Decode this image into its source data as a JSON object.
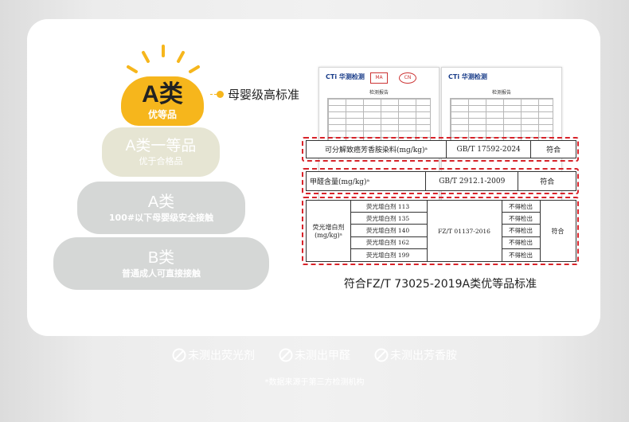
{
  "pyramid": {
    "tier_a": {
      "grade": "A类",
      "name": "优等品"
    },
    "tier_b": {
      "grade": "A类一等品",
      "name": "优于合格品"
    },
    "tier_c": {
      "grade": "A类",
      "name": "100#以下母婴级安全接触"
    },
    "tier_d": {
      "grade": "B类",
      "name": "普通成人可直接接触"
    },
    "standard_label": "母婴级高标准"
  },
  "reports": [
    {
      "logo": "CTi 华测检测",
      "title": "检测报告"
    },
    {
      "logo": "CTi 华测检测",
      "title": "检测报告"
    }
  ],
  "table": {
    "row1": {
      "item": "可分解致癌芳香胺染料(mg/kg)ᵃ",
      "standard": "GB/T 17592-2024",
      "result": "符合"
    },
    "row2": {
      "item": "甲醛含量(mg/kg)ᵃ",
      "standard": "GB/T 2912.1-2009",
      "result": "符合"
    },
    "row3": {
      "name": "荧光增白剂",
      "unit": "(mg/kg)ᵃ",
      "items": [
        "荧光增白剂 113",
        "荧光增白剂 135",
        "荧光增白剂 140",
        "荧光增白剂 162",
        "荧光增白剂 199"
      ],
      "standard": "FZ/T 01137-2016",
      "results": [
        "不得检出",
        "不得检出",
        "不得检出",
        "不得检出",
        "不得检出"
      ],
      "verdict": "符合"
    }
  },
  "caption": "符合FZ/T 73025-2019A类优等品标准",
  "bottom_items": [
    "未测出荧光剂",
    "未测出甲醛",
    "未测出芳香胺"
  ],
  "footnote": "*数据来源于第三方检测机构",
  "colors": {
    "accent": "#f6b61c",
    "highlight": "#d8232a",
    "muted": "#d5d7d6"
  }
}
